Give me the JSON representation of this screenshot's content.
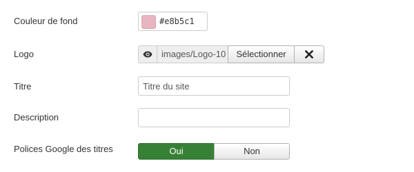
{
  "fields": {
    "bg_color": {
      "label": "Couleur de fond",
      "value": "#e8b5c1",
      "swatch_color": "#e8b5c1",
      "icon": "color-swatch"
    },
    "logo": {
      "label": "Logo",
      "path": "images/Logo-10",
      "preview_icon": "eye-icon",
      "select_label": "Sélectionner",
      "clear_icon": "close-icon"
    },
    "title": {
      "label": "Titre",
      "value": "",
      "placeholder": "Titre du site"
    },
    "description": {
      "label": "Description",
      "value": "",
      "placeholder": ""
    },
    "google_fonts": {
      "label": "Polices Google des titres",
      "yes_label": "Oui",
      "no_label": "Non",
      "selected": "Oui",
      "active_color": "#378137"
    }
  }
}
